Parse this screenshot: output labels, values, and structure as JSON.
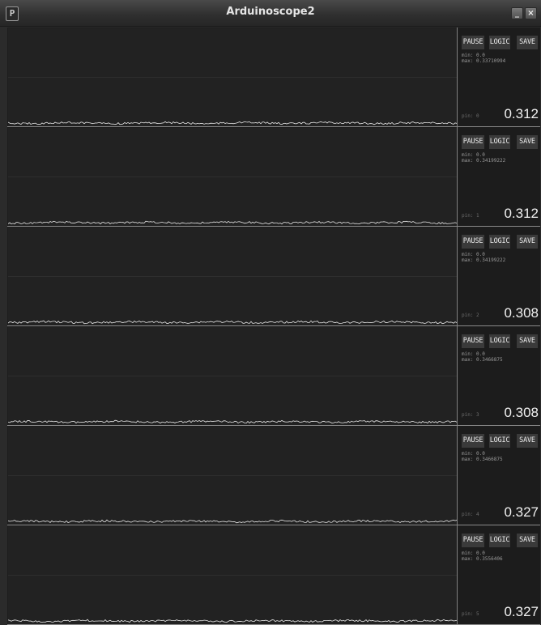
{
  "window": {
    "title": "Arduinoscope2",
    "app_icon": "P",
    "minimize_glyph": "_",
    "close_glyph": "×"
  },
  "buttons": {
    "pause": "PAUSE",
    "logic": "LOGIC",
    "save": "SAVE"
  },
  "channels": [
    {
      "min": "min: 0.0",
      "max": "max: 0.33710994",
      "pin": "pin: 0",
      "value": "0.312",
      "signal_level": 0.312
    },
    {
      "min": "min: 0.0",
      "max": "max: 0.34199222",
      "pin": "pin: 1",
      "value": "0.312",
      "signal_level": 0.312
    },
    {
      "min": "min: 0.0",
      "max": "max: 0.34199222",
      "pin": "pin: 2",
      "value": "0.308",
      "signal_level": 0.308
    },
    {
      "min": "min: 0.0",
      "max": "max: 0.3466875",
      "pin": "pin: 3",
      "value": "0.308",
      "signal_level": 0.308
    },
    {
      "min": "min: 0.0",
      "max": "max: 0.3466875",
      "pin": "pin: 4",
      "value": "0.327",
      "signal_level": 0.327
    },
    {
      "min": "min: 0.0",
      "max": "max: 0.3556406",
      "pin": "pin: 5",
      "value": "0.327",
      "signal_level": 0.327
    }
  ],
  "colors": {
    "background": "#1d1d1d",
    "trace": "#e8e8e8",
    "button": "#3a3a3a"
  }
}
